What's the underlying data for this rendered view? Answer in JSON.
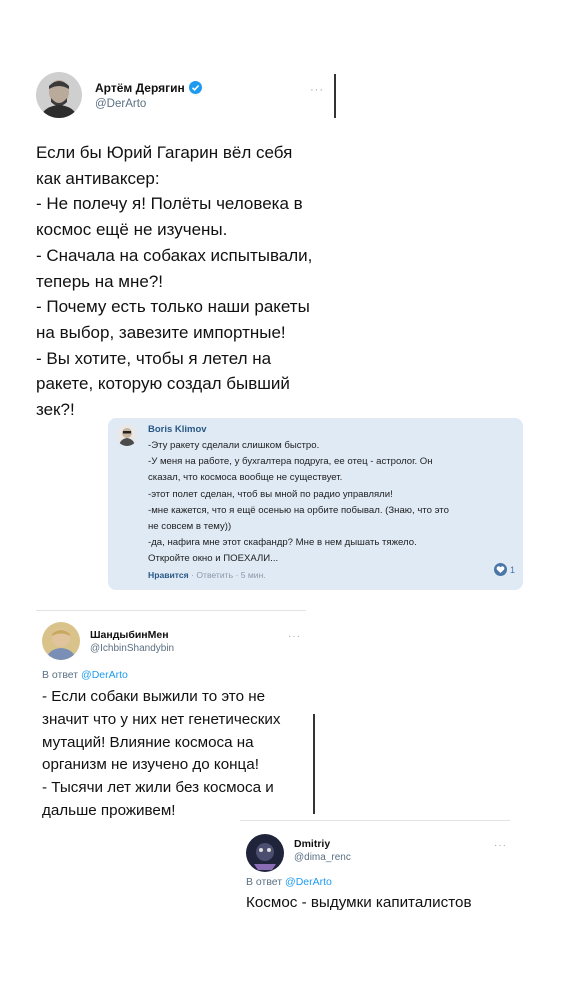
{
  "tweet_main": {
    "name": "Артём Дерягин",
    "handle": "@DerArto",
    "more": "···",
    "text": "Если бы Юрий Гагарин вёл себя\nкак антиваксер:\n- Не полечу я! Полёты человека в\nкосмос ещё не изучены.\n- Сначала на собаках испытывали,\nтеперь на мне?!\n- Почему есть только наши ракеты\nна выбор, завезите импортные!\n- Вы хотите, чтобы я летел на\nракете, которую создал бывший\nзек?!"
  },
  "vk_comment": {
    "name": "Boris Klimov",
    "text": "-Эту ракету сделали слишком быстро.\n-У меня на работе, у бухгалтера подруга, ее отец - астролог. Он\nсказал, что космоса вообще не существует.\n-этот полет сделан, чтоб вы мной по радио управляли!\n-мне кажется, что я ещё осенью на орбите побывал. (Знаю, что это\nне совсем в тему))\n-да, нафига мне этот скафандр? Мне в нем дышать тяжело.\nОткройте окно и ПОЕХАЛИ...",
    "like": "Нравится",
    "reply": "Ответить",
    "time": "5 мин.",
    "like_count": "1"
  },
  "tweet_reply1": {
    "name": "ШандыбинМен",
    "handle": "@IchbinShandybin",
    "more": "···",
    "reply_prefix": "В ответ",
    "reply_mention": "@DerArto",
    "text": "- Если собаки выжили то это не\nзначит что у них нет генетических\nмутаций! Влияние космоса на\nорганизм не изучено до конца!\n- Тысячи лет жили без космоса и\nдальше проживем!"
  },
  "tweet_reply2": {
    "name": "Dmitriy",
    "handle": "@dima_renc",
    "more": "···",
    "reply_prefix": "В ответ",
    "reply_mention": "@DerArto",
    "text": "Космос - выдумки капиталистов"
  },
  "colors": {
    "verified": "#1d9bf0",
    "vk_bg": "#dfeaf5",
    "link": "#1d9bf0"
  }
}
